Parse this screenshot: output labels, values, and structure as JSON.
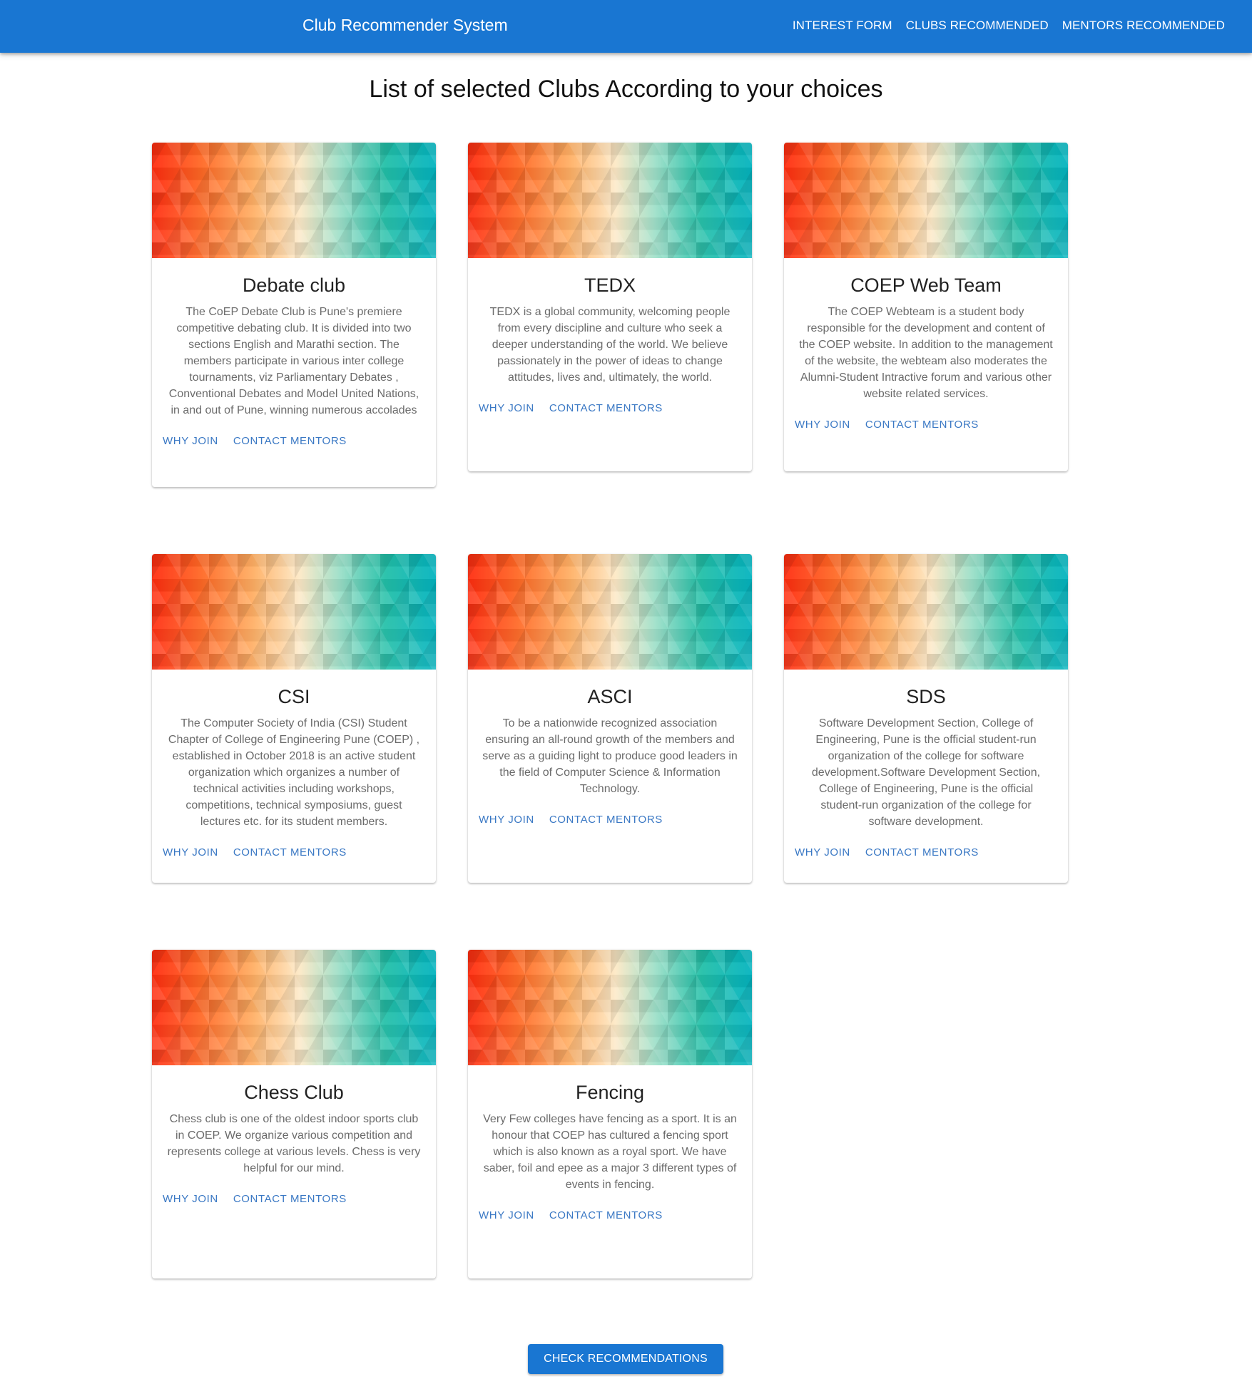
{
  "appbar": {
    "title": "Club Recommender System",
    "nav": [
      "INTEREST FORM",
      "CLUBS RECOMMENDED",
      "MENTORS RECOMMENDED"
    ]
  },
  "page": {
    "title": "List of selected Clubs According to your choices"
  },
  "cards": [
    {
      "title": "Debate club",
      "description": "The CoEP Debate Club is Pune's premiere competitive debating club. It is divided into two sections English and Marathi section. The members participate in various inter college tournaments, viz Parliamentary Debates , Conventional Debates and Model United Nations, in and out of Pune, winning numerous accolades",
      "action_why": "WHY JOIN",
      "action_contact": "CONTACT MENTORS"
    },
    {
      "title": "TEDX",
      "description": "TEDX is a global community, welcoming people from every discipline and culture who seek a deeper understanding of the world. We believe passionately in the power of ideas to change attitudes, lives and, ultimately, the world.",
      "action_why": "WHY JOIN",
      "action_contact": "CONTACT MENTORS"
    },
    {
      "title": "COEP Web Team",
      "description": "The COEP Webteam is a student body responsible for the development and content of the COEP website. In addition to the management of the website, the webteam also moderates the Alumni-Student Intractive forum and various other website related services.",
      "action_why": "WHY JOIN",
      "action_contact": "CONTACT MENTORS"
    },
    {
      "title": "CSI",
      "description": "The Computer Society of India (CSI) Student Chapter of College of Engineering Pune (COEP) , established in October 2018 is an active student organization which organizes a number of technical activities including workshops, competitions, technical symposiums, guest lectures etc. for its student members.",
      "action_why": "WHY JOIN",
      "action_contact": "CONTACT MENTORS"
    },
    {
      "title": "ASCI",
      "description": "To be a nationwide recognized association ensuring an all-round growth of the members and serve as a guiding light to produce good leaders in the field of Computer Science & Information Technology.",
      "action_why": "WHY JOIN",
      "action_contact": "CONTACT MENTORS"
    },
    {
      "title": "SDS",
      "description": "Software Development Section, College of Engineering, Pune is the official student-run organization of the college for software development.Software Development Section, College of Engineering, Pune is the official student-run organization of the college for software development.",
      "action_why": "WHY JOIN",
      "action_contact": "CONTACT MENTORS"
    },
    {
      "title": "Chess Club",
      "description": "Chess club is one of the oldest indoor sports club in COEP. We organize various competition and represents college at various levels. Chess is very helpful for our mind.",
      "action_why": "WHY JOIN",
      "action_contact": "CONTACT MENTORS"
    },
    {
      "title": "Fencing",
      "description": "Very Few colleges have fencing as a sport. It is an honour that COEP has cultured a fencing sport which is also known as a royal sport. We have saber, foil and epee as a major 3 different types of events in fencing.",
      "action_why": "WHY JOIN",
      "action_contact": "CONTACT MENTORS"
    }
  ],
  "footer": {
    "button_label": "CHECK RECOMMENDATIONS"
  },
  "colors": {
    "primary": "#1976d2",
    "action_text": "#3a78c4"
  }
}
